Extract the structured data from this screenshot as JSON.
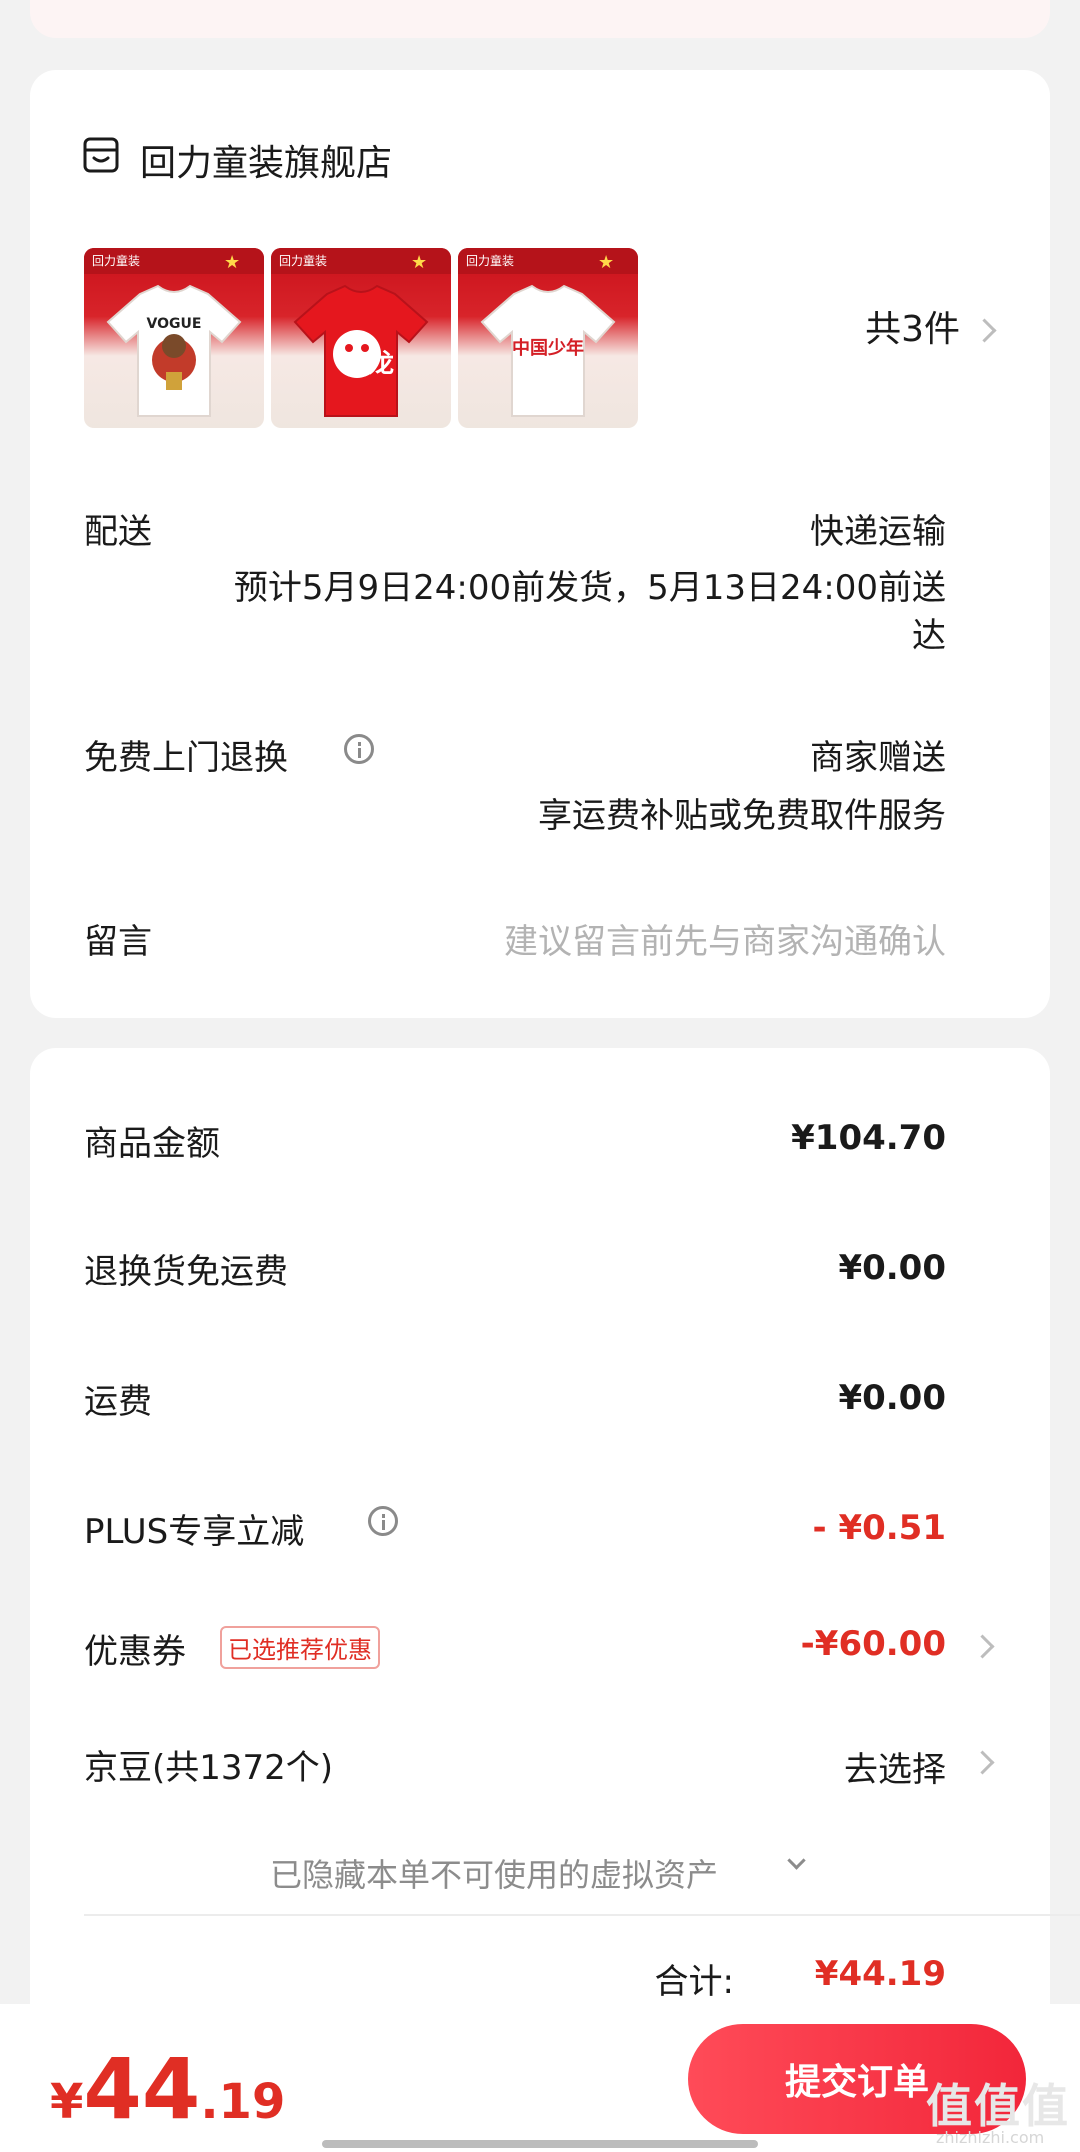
{
  "store": {
    "name": "回力童装旗舰店",
    "products": [
      {
        "name": "white-tshirt-vogue",
        "print": "VOGUE",
        "shirt_color": "#ffffff"
      },
      {
        "name": "red-tshirt-lion",
        "print": "龙",
        "shirt_color": "#e5171e"
      },
      {
        "name": "white-tshirt-china",
        "print": "中国少年",
        "shirt_color": "#ffffff"
      }
    ],
    "brand_text": "回力童装",
    "count_label": "共3件"
  },
  "delivery": {
    "label": "配送",
    "method": "快递运输",
    "estimate_line1": "预计5月9日24:00前发货，5月13日24:00前送",
    "estimate_line2": "达"
  },
  "returns": {
    "label": "免费上门退换",
    "value": "商家赠送",
    "sub": "享运费补贴或免费取件服务"
  },
  "message": {
    "label": "留言",
    "placeholder": "建议留言前先与商家沟通确认"
  },
  "amounts": {
    "goods_label": "商品金额",
    "goods_value": "¥104.70",
    "return_fee_label": "退换货免运费",
    "return_fee_value": "¥0.00",
    "shipping_label": "运费",
    "shipping_value": "¥0.00",
    "plus_label": "PLUS专享立减",
    "plus_value": "- ¥0.51",
    "coupon_label": "优惠券",
    "coupon_tag": "已选推荐优惠",
    "coupon_value": "-¥60.00",
    "beans_label": "京豆(共1372个)",
    "beans_value": "去选择",
    "hidden_assets": "已隐藏本单不可使用的虚拟资产",
    "subtotal_label": "合计:",
    "subtotal_value": "¥44.19"
  },
  "bottom": {
    "currency": "¥",
    "total_int": "44",
    "total_dec": ".19",
    "submit_label": "提交订单"
  },
  "watermark": {
    "logo": "值值值",
    "url": "zhizhizhi.com"
  },
  "colors": {
    "accent_red": "#e02e24",
    "button_start": "#ff4b58",
    "button_end": "#f2263a",
    "background": "#f2f2f2"
  }
}
